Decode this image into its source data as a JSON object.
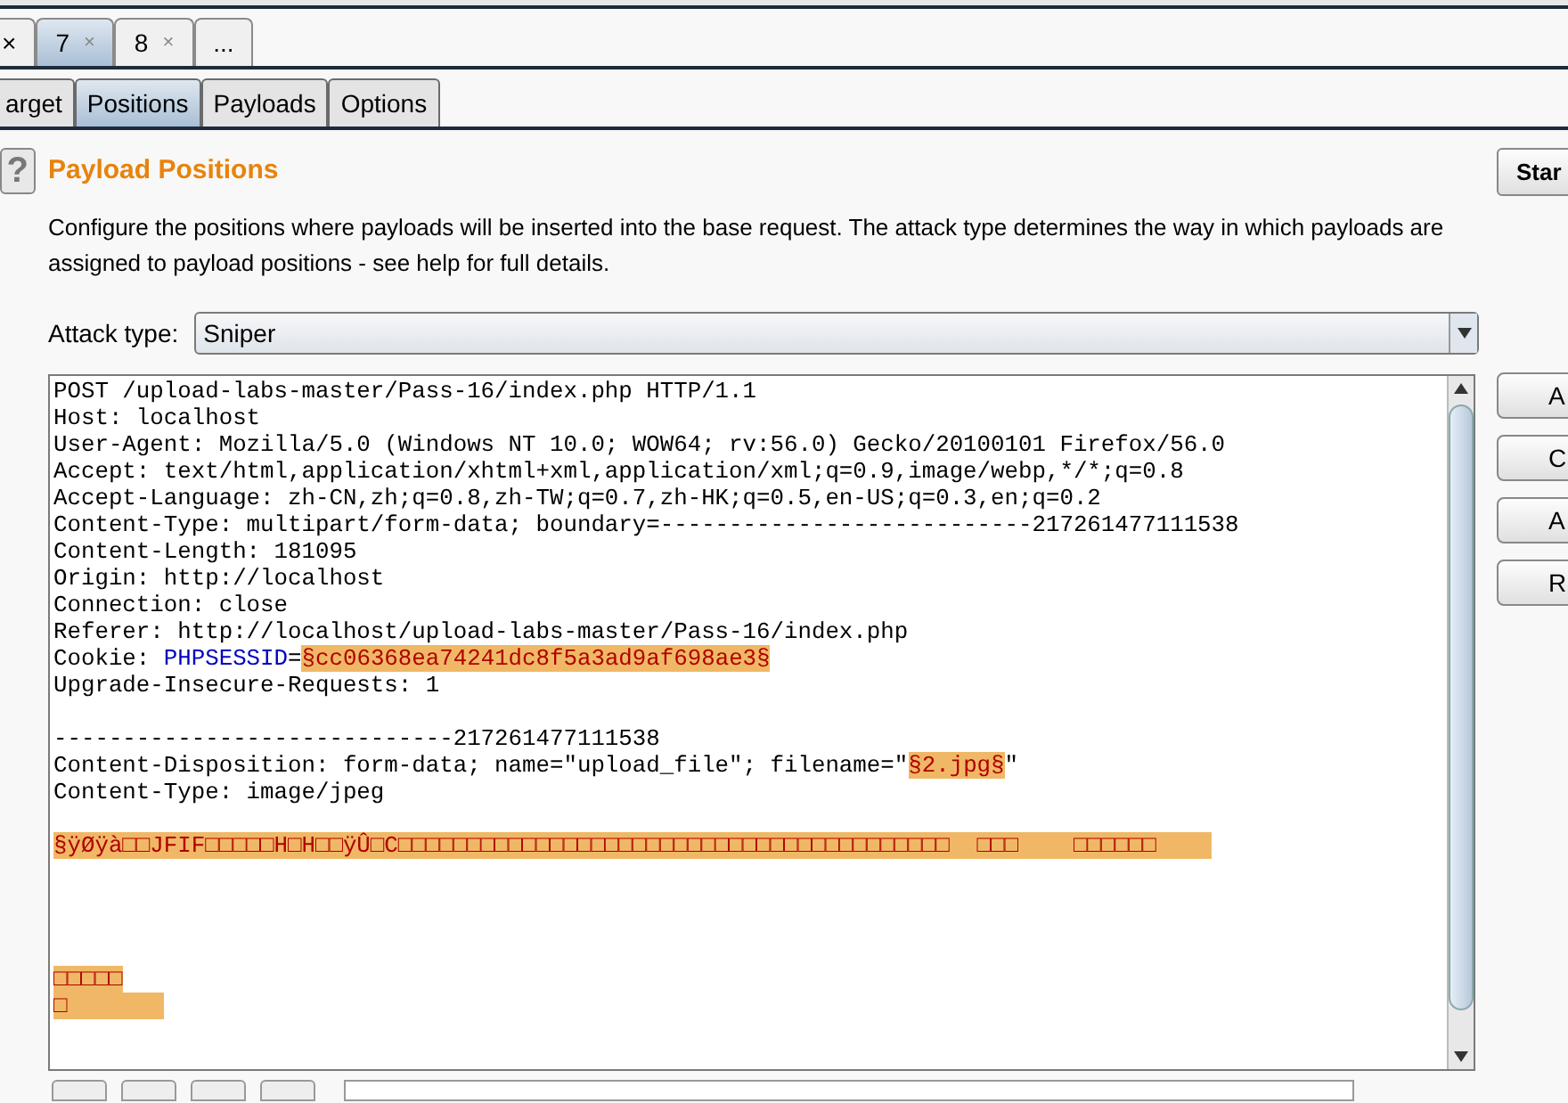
{
  "top_tabs": [
    {
      "label": "×",
      "selected": false
    },
    {
      "label": "7",
      "close": "×",
      "selected": true
    },
    {
      "label": "8",
      "close": "×",
      "selected": false
    },
    {
      "label": "...",
      "selected": false
    }
  ],
  "sub_tabs": [
    {
      "label": "arget",
      "selected": false
    },
    {
      "label": "Positions",
      "selected": true
    },
    {
      "label": "Payloads",
      "selected": false
    },
    {
      "label": "Options",
      "selected": false
    }
  ],
  "section": {
    "help": "?",
    "title": "Payload Positions",
    "description": "Configure the positions where payloads will be inserted into the base request. The attack type determines the way in which payloads are assigned to payload positions - see help for full details.",
    "start_button": "Star"
  },
  "attack_type": {
    "label": "Attack type:",
    "value": "Sniper"
  },
  "request_lines": [
    [
      {
        "kind": "plain",
        "text": "POST /upload-labs-master/Pass-16/index.php HTTP/1.1"
      }
    ],
    [
      {
        "kind": "plain",
        "text": "Host: localhost"
      }
    ],
    [
      {
        "kind": "plain",
        "text": "User-Agent: Mozilla/5.0 (Windows NT 10.0; WOW64; rv:56.0) Gecko/20100101 Firefox/56.0"
      }
    ],
    [
      {
        "kind": "plain",
        "text": "Accept: text/html,application/xhtml+xml,application/xml;q=0.9,image/webp,*/*;q=0.8"
      }
    ],
    [
      {
        "kind": "plain",
        "text": "Accept-Language: zh-CN,zh;q=0.8,zh-TW;q=0.7,zh-HK;q=0.5,en-US;q=0.3,en;q=0.2"
      }
    ],
    [
      {
        "kind": "plain",
        "text": "Content-Type: multipart/form-data; boundary=---------------------------217261477111538"
      }
    ],
    [
      {
        "kind": "plain",
        "text": "Content-Length: 181095"
      }
    ],
    [
      {
        "kind": "plain",
        "text": "Origin: http://localhost"
      }
    ],
    [
      {
        "kind": "plain",
        "text": "Connection: close"
      }
    ],
    [
      {
        "kind": "plain",
        "text": "Referer: http://localhost/upload-labs-master/Pass-16/index.php"
      }
    ],
    [
      {
        "kind": "plain",
        "text": "Cookie: "
      },
      {
        "kind": "param",
        "text": "PHPSESSID"
      },
      {
        "kind": "plain",
        "text": "="
      },
      {
        "kind": "payload",
        "text": "§cc06368ea74241dc8f5a3ad9af698ae3§"
      }
    ],
    [
      {
        "kind": "plain",
        "text": "Upgrade-Insecure-Requests: 1"
      }
    ],
    [
      {
        "kind": "blank"
      }
    ],
    [
      {
        "kind": "plain",
        "text": "-----------------------------217261477111538"
      }
    ],
    [
      {
        "kind": "plain",
        "text": "Content-Disposition: form-data; name=\"upload_file\"; filename=\""
      },
      {
        "kind": "payload",
        "text": "§2.jpg§"
      },
      {
        "kind": "plain",
        "text": "\""
      }
    ],
    [
      {
        "kind": "plain",
        "text": "Content-Type: image/jpeg"
      }
    ],
    [
      {
        "kind": "blank"
      }
    ],
    [
      {
        "kind": "payload",
        "text": "§ÿØÿà□□JFIF□□□□□H□H□□ÿÛ□C□□□□□□□□□□□□□□□□□□□□□□□□□□□□□□□□□□□□□□□□  □□□    □□□□□□    "
      }
    ],
    [
      {
        "kind": "blank"
      }
    ],
    [
      {
        "kind": "blank"
      }
    ],
    [
      {
        "kind": "blank"
      }
    ],
    [
      {
        "kind": "blank"
      }
    ],
    [
      {
        "kind": "payload",
        "text": "□□□□□"
      }
    ],
    [
      {
        "kind": "payload",
        "text": "□       "
      }
    ]
  ],
  "side_buttons": [
    "A",
    "C",
    "A",
    "R"
  ]
}
